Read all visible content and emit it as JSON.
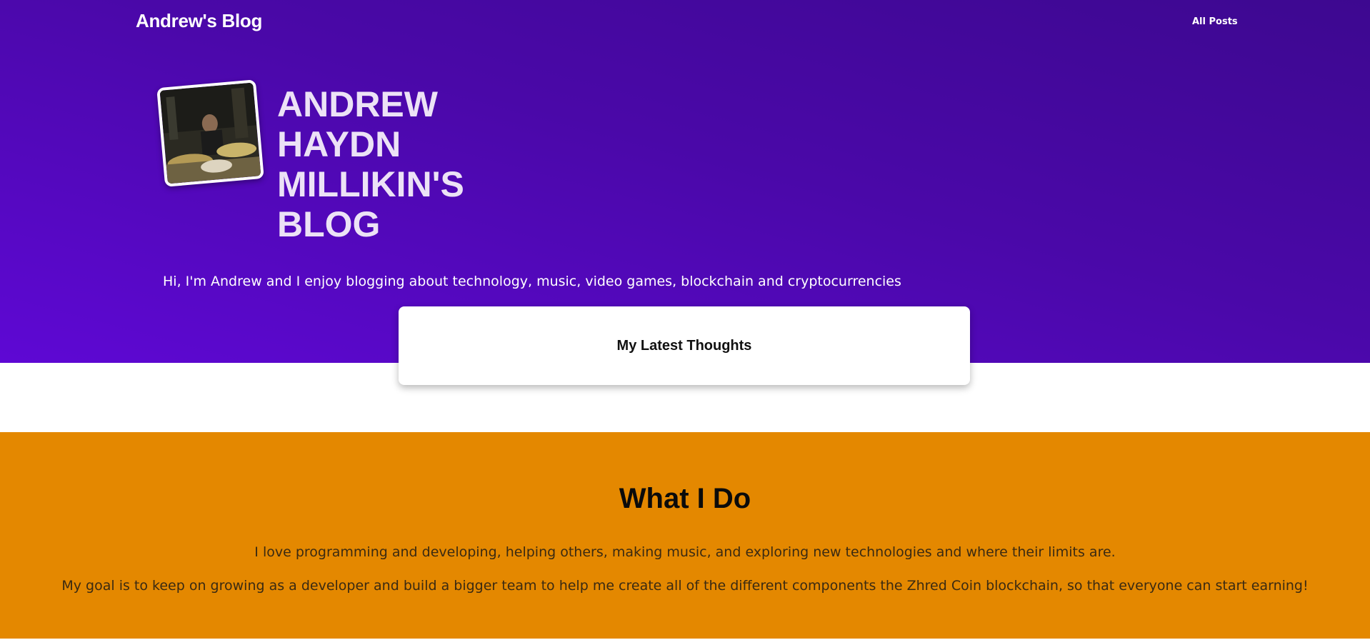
{
  "header": {
    "brand": "Andrew's Blog",
    "nav": {
      "all_posts": "All Posts"
    }
  },
  "hero": {
    "avatar_alt": "Andrew playing drums",
    "title": "Andrew Haydn Millikin's Blog",
    "intro": "Hi, I'm Andrew and I enjoy blogging about technology, music, video games, blockchain and cryptocurrencies"
  },
  "latest": {
    "label": "My Latest Thoughts"
  },
  "what_i_do": {
    "heading": "What I Do",
    "paragraphs": [
      "I love programming and developing, helping others, making music, and exploring new technologies and where their limits are.",
      "My goal is to keep on growing as a developer and build a bigger team to help me create all of the different components the Zhred Coin blockchain, so that everyone can start earning!"
    ]
  },
  "colors": {
    "hero_gradient_top": "#3d0890",
    "hero_gradient_bottom": "#5e08d4",
    "accent_orange": "#e48800",
    "title_text": "#ece2f6"
  }
}
